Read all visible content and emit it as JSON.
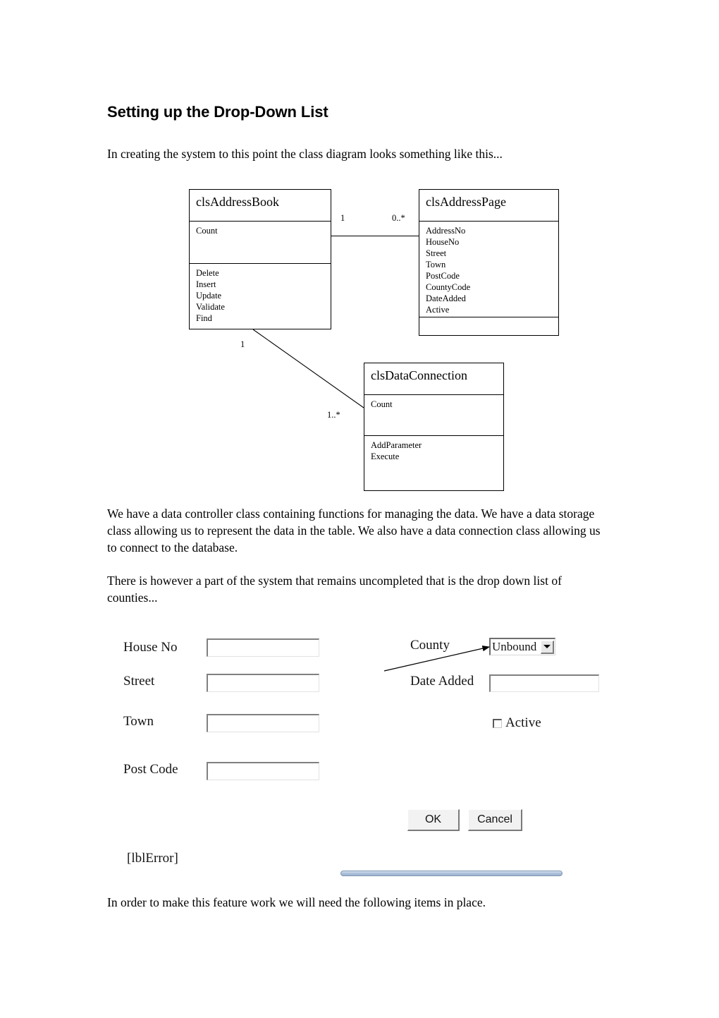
{
  "document": {
    "heading": "Setting up the Drop-Down List",
    "paragraphs": {
      "intro": "In creating the system to this point the class diagram looks something like this...",
      "classes": "We have a data controller class containing functions for managing the data.  We have a data storage class allowing us to represent the data in the table.  We also have a data connection class allowing us to connect to the database.",
      "dropdown": "There is however a part of the system that remains uncompleted that is the drop down list of counties...",
      "closing": "In order to make this feature work we will need the following items in place."
    }
  },
  "class_diagram": {
    "classes": [
      {
        "name": "clsAddressBook",
        "attributes": [
          "Count"
        ],
        "operations": [
          "Delete",
          "Insert",
          "Update",
          "Validate",
          "Find"
        ]
      },
      {
        "name": "clsAddressPage",
        "attributes": [
          "AddressNo",
          "HouseNo",
          "Street",
          "Town",
          "PostCode",
          "CountyCode",
          "DateAdded",
          "Active"
        ],
        "operations": []
      },
      {
        "name": "clsDataConnection",
        "attributes": [
          "Count"
        ],
        "operations": [
          "AddParameter",
          "Execute"
        ]
      }
    ],
    "multiplicities": {
      "addressbook_to_addresspage_source": "1",
      "addressbook_to_addresspage_target": "0..*",
      "addressbook_to_dataconnection_source": "1",
      "addressbook_to_dataconnection_target": "1..*"
    }
  },
  "form": {
    "labels": {
      "house_no": "House No",
      "street": "Street",
      "town": "Town",
      "post_code": "Post Code",
      "county": "County",
      "date_added": "Date Added",
      "active": "Active",
      "error": "[lblError]"
    },
    "fields": {
      "house_no_value": "",
      "street_value": "",
      "town_value": "",
      "post_code_value": "",
      "date_added_value": "",
      "county_value": "Unbound",
      "active_checked": false
    },
    "buttons": {
      "ok": "OK",
      "cancel": "Cancel"
    }
  }
}
